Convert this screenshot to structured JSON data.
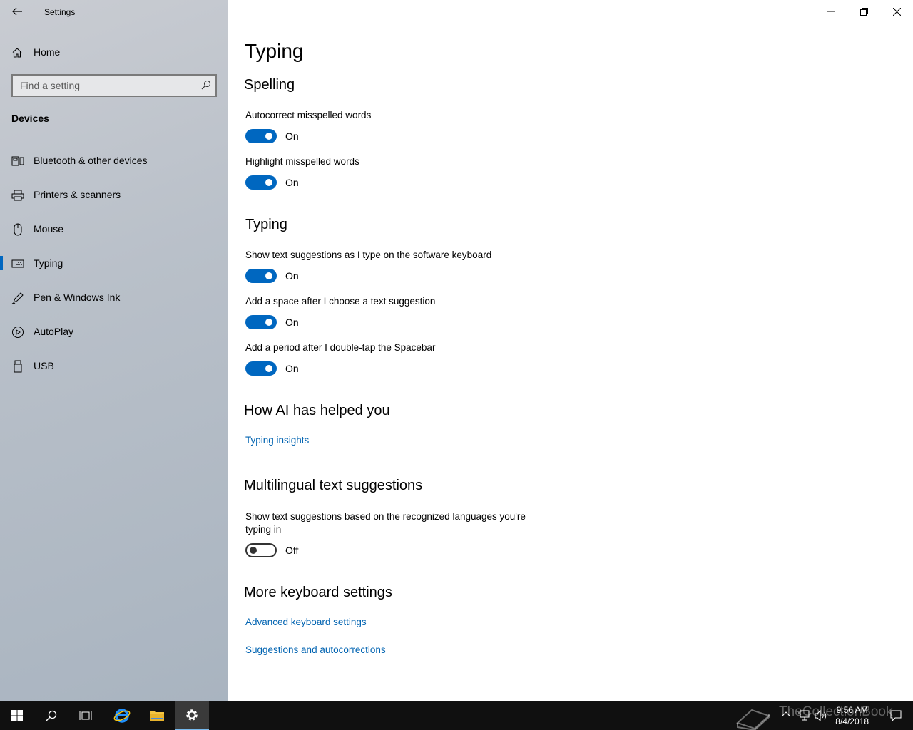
{
  "window": {
    "app_title": "Settings"
  },
  "sidebar": {
    "home_label": "Home",
    "search_placeholder": "Find a setting",
    "section_label": "Devices",
    "items": [
      {
        "label": "Bluetooth & other devices",
        "icon": "bluetooth-devices-icon"
      },
      {
        "label": "Printers & scanners",
        "icon": "printer-icon"
      },
      {
        "label": "Mouse",
        "icon": "mouse-icon"
      },
      {
        "label": "Typing",
        "icon": "keyboard-icon",
        "selected": true
      },
      {
        "label": "Pen & Windows Ink",
        "icon": "pen-icon"
      },
      {
        "label": "AutoPlay",
        "icon": "autoplay-icon"
      },
      {
        "label": "USB",
        "icon": "usb-icon"
      }
    ]
  },
  "main": {
    "title": "Typing",
    "spelling": {
      "heading": "Spelling",
      "autocorrect": {
        "label": "Autocorrect misspelled words",
        "state": "On"
      },
      "highlight": {
        "label": "Highlight misspelled words",
        "state": "On"
      }
    },
    "typing": {
      "heading": "Typing",
      "suggestions": {
        "label": "Show text suggestions as I type on the software keyboard",
        "state": "On"
      },
      "space": {
        "label": "Add a space after I choose a text suggestion",
        "state": "On"
      },
      "period": {
        "label": "Add a period after I double-tap the Spacebar",
        "state": "On"
      }
    },
    "ai": {
      "heading": "How AI has helped you",
      "link": "Typing insights"
    },
    "multilingual": {
      "heading": "Multilingual text suggestions",
      "option": {
        "label": "Show text suggestions based on the recognized languages you're typing in",
        "state": "Off"
      }
    },
    "more": {
      "heading": "More keyboard settings",
      "link1": "Advanced keyboard settings",
      "link2": "Suggestions and autocorrections"
    }
  },
  "taskbar": {
    "time": "9:56 AM",
    "date": "8/4/2018",
    "watermark": "TheCollectionBook",
    "accent": "#0067c0"
  }
}
